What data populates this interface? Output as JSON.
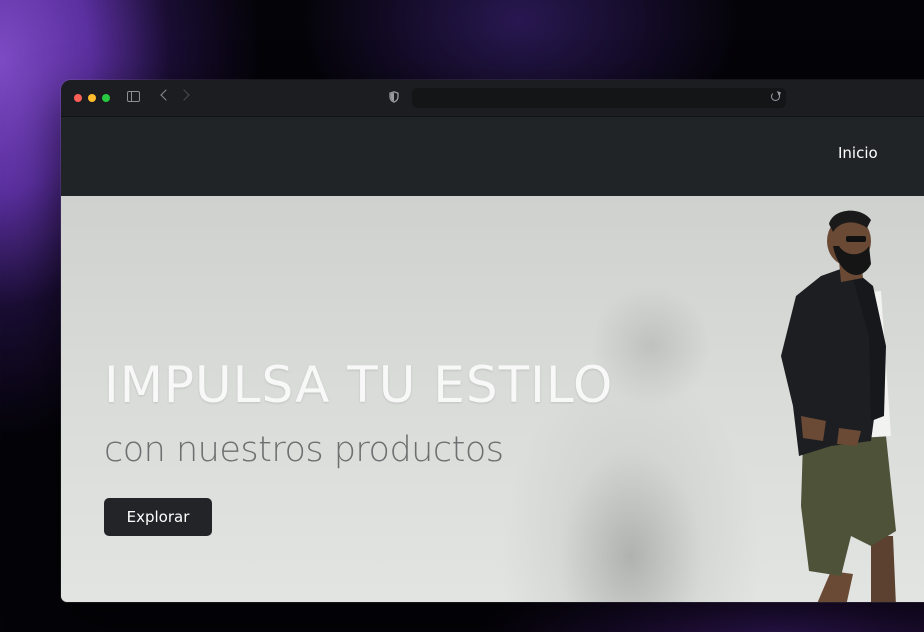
{
  "browser": {
    "url": ""
  },
  "navbar": {
    "link_label": "Inicio"
  },
  "hero": {
    "title": "IMPULSA TU ESTILO",
    "subtitle": "con nuestros productos",
    "button_label": "Explorar"
  },
  "colors": {
    "navbar_bg": "#212427",
    "button_bg": "#222427",
    "hero_bg": "#dadcda"
  }
}
